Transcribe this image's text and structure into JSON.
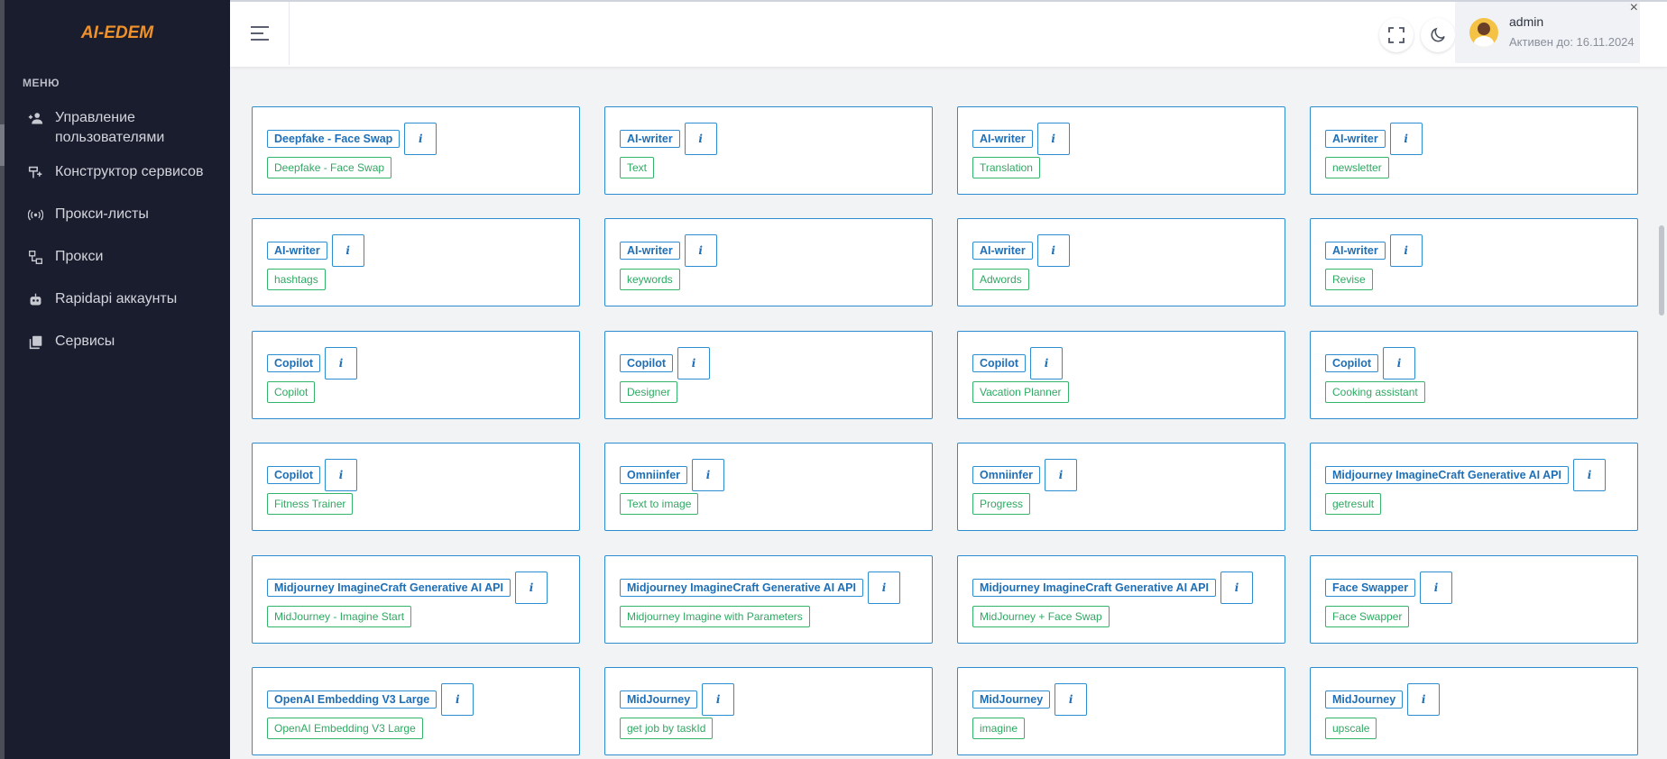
{
  "app": {
    "logo": "AI-EDEM",
    "menu_caption": "МЕНЮ"
  },
  "sidebar": {
    "items": [
      {
        "label": "Управление пользователями",
        "icon": "users-icon"
      },
      {
        "label": "Конструктор сервисов",
        "icon": "builder-icon"
      },
      {
        "label": "Прокси-листы",
        "icon": "broadcast-icon"
      },
      {
        "label": "Прокси",
        "icon": "network-icon"
      },
      {
        "label": "Rapidapi аккаунты",
        "icon": "robot-icon"
      },
      {
        "label": "Сервисы",
        "icon": "copy-icon"
      }
    ]
  },
  "header": {
    "user_name": "admin",
    "user_sub": "Активен до: 16.11.2024",
    "close_symbol": "×"
  },
  "info_symbol": "i",
  "cards": [
    {
      "service": "",
      "endpoint": ""
    },
    {
      "service": "",
      "endpoint": ""
    },
    {
      "service": "",
      "endpoint": ""
    },
    {
      "service": "",
      "endpoint": ""
    },
    {
      "service": "Deepfake - Face Swap",
      "endpoint": "Deepfake - Face Swap"
    },
    {
      "service": "AI-writer",
      "endpoint": "Text"
    },
    {
      "service": "AI-writer",
      "endpoint": "Translation"
    },
    {
      "service": "AI-writer",
      "endpoint": "newsletter"
    },
    {
      "service": "AI-writer",
      "endpoint": "hashtags"
    },
    {
      "service": "AI-writer",
      "endpoint": "keywords"
    },
    {
      "service": "AI-writer",
      "endpoint": "Adwords"
    },
    {
      "service": "AI-writer",
      "endpoint": "Revise"
    },
    {
      "service": "Copilot",
      "endpoint": "Copilot"
    },
    {
      "service": "Copilot",
      "endpoint": "Designer"
    },
    {
      "service": "Copilot",
      "endpoint": "Vacation Planner"
    },
    {
      "service": "Copilot",
      "endpoint": "Cooking assistant"
    },
    {
      "service": "Copilot",
      "endpoint": "Fitness Trainer"
    },
    {
      "service": "Omniinfer",
      "endpoint": "Text to image"
    },
    {
      "service": "Omniinfer",
      "endpoint": "Progress"
    },
    {
      "service": "Midjourney ImagineCraft Generative AI API",
      "endpoint": "getresult"
    },
    {
      "service": "Midjourney ImagineCraft Generative AI API",
      "endpoint": "MidJourney - Imagine Start"
    },
    {
      "service": "Midjourney ImagineCraft Generative AI API",
      "endpoint": "Midjourney Imagine with Parameters"
    },
    {
      "service": "Midjourney ImagineCraft Generative AI API",
      "endpoint": "MidJourney + Face Swap"
    },
    {
      "service": "Face Swapper",
      "endpoint": "Face Swapper"
    },
    {
      "service": "OpenAI Embedding V3 Large",
      "endpoint": "OpenAI Embedding V3 Large"
    },
    {
      "service": "MidJourney",
      "endpoint": "get job by taskId"
    },
    {
      "service": "MidJourney",
      "endpoint": "imagine"
    },
    {
      "service": "MidJourney",
      "endpoint": "upscale"
    }
  ]
}
